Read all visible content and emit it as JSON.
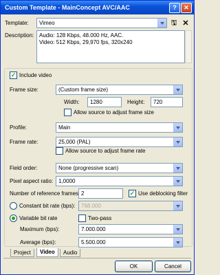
{
  "window": {
    "title": "Custom Template - MainConcept AVC/AAC",
    "help_glyph": "?",
    "close_glyph": "✕"
  },
  "template": {
    "label": "Template:",
    "value": "Vimeo"
  },
  "description": {
    "label": "Description:",
    "lines": [
      "Audio: 128 Kbps, 48.000 Hz, AAC.",
      "Video: 512 Kbps, 29,970 fps, 320x240"
    ]
  },
  "video": {
    "include_label": "Include video",
    "include_checked": true,
    "frame_size": {
      "label": "Frame size:",
      "value": "(Custom frame size)"
    },
    "width": {
      "label": "Width:",
      "value": "1280"
    },
    "height": {
      "label": "Height:",
      "value": "720"
    },
    "allow_frame_size": {
      "label": "Allow source to adjust frame size",
      "checked": false
    },
    "profile": {
      "label": "Profile:",
      "value": "Main"
    },
    "frame_rate": {
      "label": "Frame rate:",
      "value": "25,000 (PAL)"
    },
    "allow_frame_rate": {
      "label": "Allow source to adjust frame rate",
      "checked": false
    },
    "field_order": {
      "label": "Field order:",
      "value": "None (progressive scan)"
    },
    "pixel_aspect": {
      "label": "Pixel aspect ratio:",
      "value": "1,0000"
    },
    "ref_frames": {
      "label": "Number of reference frames:",
      "value": "2"
    },
    "deblocking": {
      "label": "Use deblocking filter",
      "checked": true
    },
    "cbr": {
      "label": "Constant bit rate (bps):",
      "value": "768.000",
      "selected": false
    },
    "vbr": {
      "label": "Variable bit rate",
      "selected": true
    },
    "two_pass": {
      "label": "Two-pass",
      "checked": false
    },
    "maximum": {
      "label": "Maximum (bps):",
      "value": "7.000.000"
    },
    "average": {
      "label": "Average (bps):",
      "value": "5.500.000"
    }
  },
  "tabs": [
    {
      "label": "Project",
      "active": false
    },
    {
      "label": "Video",
      "active": true
    },
    {
      "label": "Audio",
      "active": false
    }
  ],
  "buttons": {
    "ok": "OK",
    "cancel": "Cancel"
  },
  "colors": {
    "titlebar": "#0a52d9",
    "window_bg": "#ece9d8",
    "check_green": "#21a121"
  }
}
